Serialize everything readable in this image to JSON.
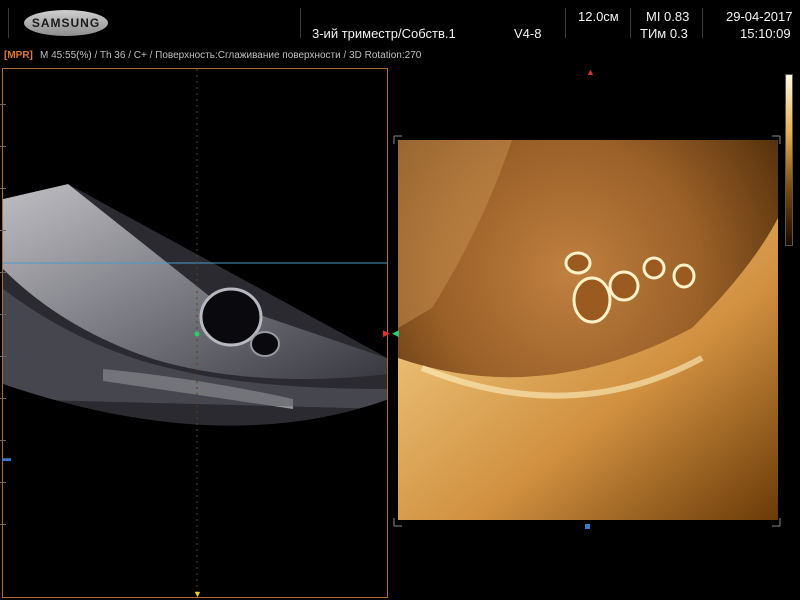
{
  "header": {
    "brand": "SAMSUNG",
    "preset": "3-ий триместр/Собств.1",
    "probe": "V4-8",
    "depth": "12.0см",
    "mi": "MI  0.83",
    "tim": "ТИм 0.3",
    "date": "29-04-2017",
    "time": "15:10:09"
  },
  "info_bar": {
    "mode_tag": "[MPR]",
    "params": "M 45:55(%) / Th 36 / C+ / Поверхность:Сглаживание поверхности / 3D Rotation:270"
  },
  "colors": {
    "accent_orange": "#b06a2e",
    "guide_line_blue": "#4a9acb",
    "marker_green": "#2ecc71",
    "marker_red": "#e03030",
    "marker_yellow": "#f0d020"
  },
  "icons": {
    "logo": "samsung-logo",
    "colorbar": "grayscale-map-bar"
  }
}
